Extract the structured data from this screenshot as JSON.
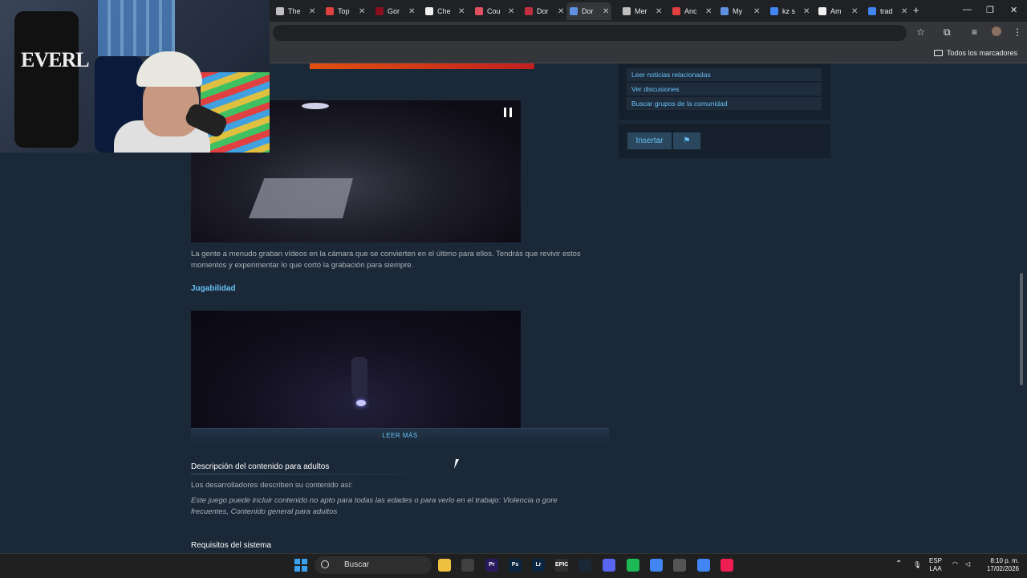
{
  "browser": {
    "tabs": [
      {
        "title": "The",
        "color": "#c0c0c0"
      },
      {
        "title": "Top",
        "color": "#e04040"
      },
      {
        "title": "Gor",
        "color": "#8a1020"
      },
      {
        "title": "Che",
        "color": "#f0f0f0"
      },
      {
        "title": "Cou",
        "color": "#e05060"
      },
      {
        "title": "Dor",
        "color": "#c03040"
      },
      {
        "title": "Dor",
        "color": "#6090e0"
      },
      {
        "title": "Mer",
        "color": "#c0c0c0"
      },
      {
        "title": "Anc",
        "color": "#e04040"
      },
      {
        "title": "My",
        "color": "#6090e0"
      },
      {
        "title": "kz s",
        "color": "#4285f4"
      },
      {
        "title": "Am",
        "color": "#f0f0f0"
      },
      {
        "title": "trad",
        "color": "#4285f4"
      }
    ],
    "bookmarks_all": "Todos los marcadores"
  },
  "sidebar": {
    "links": [
      "Leer noticias relacionadas",
      "Ver discusiones",
      "Buscar grupos de la comunidad"
    ],
    "insert_label": "Insertar",
    "flag_icon": "flag-icon"
  },
  "main": {
    "description": "La gente a menudo graban vídeos en la cámara que se convierten en el último para ellos. Tendrás que revivir estos momentos y experimentar lo que cortó la grabación para siempre.",
    "gameplay_heading": "Jugabilidad",
    "read_more": "LEER MÁS",
    "adult_heading": "Descripción del contenido para adultos",
    "adult_intro": "Los desarrolladores describen su contenido así:",
    "adult_text": "Este juego puede incluir contenido no apto para todas las edades o para verlo en el trabajo: Violencia o gore frecuentes, Contenido general para adultos",
    "requirements_heading": "Requisitos del sistema"
  },
  "webcam": {
    "bag_text": "EVERL"
  },
  "taskbar": {
    "search_placeholder": "Buscar",
    "language": "ESP",
    "layout": "LAA",
    "time": "8:10 p. m.",
    "date": "17/02/2026",
    "apps": [
      {
        "label": "",
        "color": "#f0c040"
      },
      {
        "label": "",
        "color": "#404040"
      },
      {
        "label": "Pr",
        "color": "#2a1a5e"
      },
      {
        "label": "Ps",
        "color": "#0a2540"
      },
      {
        "label": "Lr",
        "color": "#0a2540"
      },
      {
        "label": "EPIC",
        "color": "#303030"
      },
      {
        "label": "",
        "color": "#1b2838"
      },
      {
        "label": "",
        "color": "#5865f2"
      },
      {
        "label": "",
        "color": "#1db954"
      },
      {
        "label": "",
        "color": "#4285f4"
      },
      {
        "label": "",
        "color": "#555555"
      },
      {
        "label": "",
        "color": "#4285f4"
      },
      {
        "label": "",
        "color": "#ee1d52"
      }
    ]
  }
}
